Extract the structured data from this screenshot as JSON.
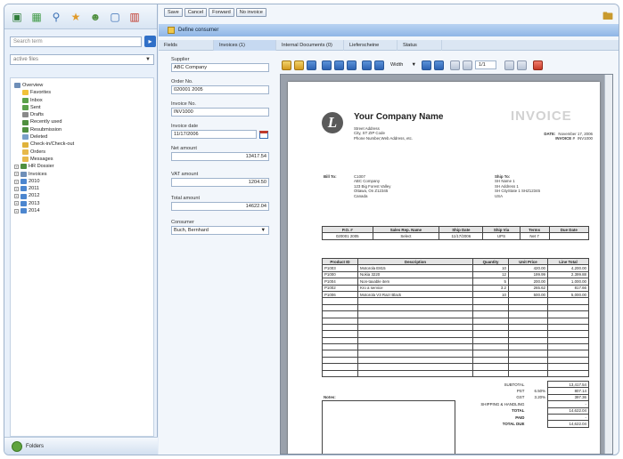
{
  "left": {
    "search_placeholder": "Search term",
    "filter_value": "active files",
    "tree": [
      {
        "label": "Overview",
        "indent": 0,
        "color": "#6f8fb8",
        "pm": ""
      },
      {
        "label": "Favorites",
        "indent": 1,
        "color": "#f0c23a",
        "pm": ""
      },
      {
        "label": "Inbox",
        "indent": 1,
        "color": "#5aa14a",
        "pm": ""
      },
      {
        "label": "Sent",
        "indent": 1,
        "color": "#5aa14a",
        "pm": ""
      },
      {
        "label": "Drafts",
        "indent": 1,
        "color": "#8a8a8a",
        "pm": ""
      },
      {
        "label": "Recently used",
        "indent": 1,
        "color": "#4f8f3f",
        "pm": ""
      },
      {
        "label": "Resubmission",
        "indent": 1,
        "color": "#4f8f3f",
        "pm": ""
      },
      {
        "label": "Deleted",
        "indent": 1,
        "color": "#7aa0c8",
        "pm": ""
      },
      {
        "label": "Check-in/Check-out",
        "indent": 1,
        "color": "#e0b23a",
        "pm": ""
      },
      {
        "label": "Orders",
        "indent": 1,
        "color": "#e7b94a",
        "pm": ""
      },
      {
        "label": "Messages",
        "indent": 1,
        "color": "#e7b94a",
        "pm": ""
      },
      {
        "label": "HR Dossier",
        "indent": 0,
        "color": "#4f8f3f",
        "pm": "+"
      },
      {
        "label": "Invoices",
        "indent": 0,
        "color": "#6f8fb8",
        "pm": "+"
      },
      {
        "label": "2010",
        "indent": 0,
        "color": "#4c86cf",
        "pm": "+"
      },
      {
        "label": "2011",
        "indent": 0,
        "color": "#4c86cf",
        "pm": "+"
      },
      {
        "label": "2012",
        "indent": 0,
        "color": "#4c86cf",
        "pm": "+"
      },
      {
        "label": "2013",
        "indent": 0,
        "color": "#4c86cf",
        "pm": "+"
      },
      {
        "label": "2014",
        "indent": 0,
        "color": "#4c86cf",
        "pm": "+"
      }
    ],
    "folders_label": "Folders"
  },
  "toolbar": {
    "save": "Save",
    "cancel": "Cancel",
    "forward": "Forward",
    "no_invoice": "No invoice"
  },
  "consumer_label": "Define consumer",
  "tabs": [
    "Fields",
    "Invoices (1)",
    "Internal Documents (0)",
    "Lieferscheine",
    "Status"
  ],
  "form": {
    "supplier_label": "Supplier",
    "supplier": "ABC Company",
    "order_label": "Order No.",
    "order": "020001 2005",
    "invoice_no_label": "Invoice No.",
    "invoice_no": "INV1000",
    "invoice_date_label": "Invoice date",
    "invoice_date": "11/17/2006",
    "net_label": "Net amount",
    "net": "13417.54",
    "vat_label": "VAT amount",
    "vat": "1204.50",
    "total_label": "Total amount",
    "total": "14622.04",
    "consumer_label": "Consumer",
    "consumer": "Buch, Bernhard"
  },
  "viewer": {
    "zoom": "Width",
    "page": "1/1"
  },
  "invoice": {
    "company": "Your Company Name",
    "address": [
      "Street Address",
      "City, ST ZIP Code",
      "Phone Number,Web Address, etc."
    ],
    "title": "INVOICE",
    "date_label": "DATE:",
    "date": "November 17, 2006",
    "no_label": "INVOICE #",
    "no": "INV1000",
    "bill_to_label": "Bill To:",
    "bill_to": [
      "C1007",
      "ABC Company",
      "123 Big Forest Valley",
      "Ottawa, On Z12345",
      "Canada"
    ],
    "ship_to_label": "Ship To:",
    "ship_to": [
      "SH Name 1",
      "SH Address 1",
      "SH CityState 1 SHZ12345",
      "USA"
    ],
    "order_headers": [
      "P.O. #",
      "Sales Rep. Name",
      "Ship Date",
      "Ship Via",
      "Terms",
      "Due Date"
    ],
    "order_row": [
      "020001 2005",
      "Select",
      "11/17/2006",
      "UPS",
      "Net 7",
      ""
    ],
    "item_headers": [
      "Product ID",
      "Description",
      "Quantity",
      "Unit Price",
      "Line Total"
    ],
    "items": [
      [
        "P1003",
        "Motorola E815",
        "10",
        "420.00",
        "4,200.00"
      ],
      [
        "P1000",
        "Nokia 3220",
        "12",
        "199.99",
        "2,399.88"
      ],
      [
        "P1004",
        "Non-taxable item",
        "5",
        "200.00",
        "1,000.00"
      ],
      [
        "P1002",
        "Kro a service",
        "3.2",
        "265.62",
        "817.66"
      ],
      [
        "P1006",
        "Motorola V3 Razr Black",
        "10",
        "500.00",
        "5,000.00"
      ]
    ],
    "notes_label": "Notes:",
    "totals": [
      {
        "label": "SUBTOTAL",
        "rate": "",
        "value": "13,417.54"
      },
      {
        "label": "PST",
        "rate": "6.50%",
        "value": "807.14"
      },
      {
        "label": "GST",
        "rate": "3.20%",
        "value": "397.36"
      },
      {
        "label": "SHIPPING & HANDLING",
        "rate": "",
        "value": "-"
      },
      {
        "label": "TOTAL",
        "rate": "",
        "value": "14,622.04"
      },
      {
        "label": "PAID",
        "rate": "",
        "value": "-"
      },
      {
        "label": "TOTAL DUE",
        "rate": "",
        "value": "14,622.04"
      }
    ]
  }
}
